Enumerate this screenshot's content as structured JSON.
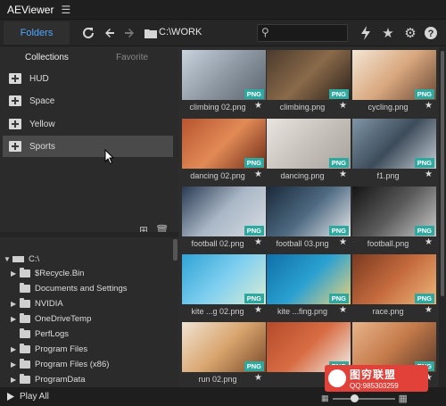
{
  "app": {
    "title": "AEViewer"
  },
  "toolbar": {
    "folders_tab": "Folders",
    "path": "C:\\WORK",
    "search_placeholder": ""
  },
  "left": {
    "tabs": [
      "Collections",
      "Favorite"
    ],
    "collections": [
      "HUD",
      "Space",
      "Yellow",
      "Sports"
    ],
    "selected_collection": "Sports",
    "tree": [
      {
        "label": "C:\\",
        "type": "drive",
        "expanded": true
      },
      {
        "label": "$Recycle.Bin",
        "type": "folder"
      },
      {
        "label": "Documents and Settings",
        "type": "folder-noarrow"
      },
      {
        "label": "NVIDIA",
        "type": "folder"
      },
      {
        "label": "OneDriveTemp",
        "type": "folder"
      },
      {
        "label": "PerfLogs",
        "type": "folder-noarrow"
      },
      {
        "label": "Program Files",
        "type": "folder"
      },
      {
        "label": "Program Files (x86)",
        "type": "folder"
      },
      {
        "label": "ProgramData",
        "type": "folder"
      }
    ]
  },
  "grid": {
    "badge": "PNG",
    "items": [
      {
        "name": "climbing 02.png",
        "colors": [
          "#c9d3dc",
          "#8e99a4",
          "#5a6570"
        ]
      },
      {
        "name": "climbing.png",
        "colors": [
          "#4a3a2c",
          "#8a6a4a",
          "#2b211a"
        ]
      },
      {
        "name": "cycling.png",
        "colors": [
          "#f4e6d4",
          "#d9a880",
          "#6b4a35"
        ]
      },
      {
        "name": "dancing 02.png",
        "colors": [
          "#b7542f",
          "#e28a56",
          "#6e2b18"
        ]
      },
      {
        "name": "dancing.png",
        "colors": [
          "#e9e4df",
          "#c8c2bd",
          "#a8a29c"
        ]
      },
      {
        "name": "f1.png",
        "colors": [
          "#7f95a6",
          "#3d4c5a",
          "#c4cdd4"
        ]
      },
      {
        "name": "football 02.png",
        "colors": [
          "#2a3a52",
          "#a9b7c6",
          "#d8dde3"
        ]
      },
      {
        "name": "football 03.png",
        "colors": [
          "#1a2a3a",
          "#4e6a82",
          "#e6e8ea"
        ]
      },
      {
        "name": "football.png",
        "colors": [
          "#141414",
          "#5a5a5a",
          "#c9c9c9"
        ]
      },
      {
        "name": "kite ...g 02.png",
        "colors": [
          "#2fa3d6",
          "#7fcff0",
          "#d9ecd4"
        ]
      },
      {
        "name": "kite ...fing.png",
        "colors": [
          "#0f6fa8",
          "#2ba1d1",
          "#e8d27a"
        ]
      },
      {
        "name": "race.png",
        "colors": [
          "#7a3a20",
          "#c56a3e",
          "#efb77a"
        ]
      },
      {
        "name": "run 02.png",
        "colors": [
          "#f0e3d2",
          "#d9a56e",
          "#7a4a2a"
        ]
      },
      {
        "name": "",
        "colors": [
          "#b44a2a",
          "#d86d44",
          "#f1efe9"
        ]
      },
      {
        "name": "",
        "colors": [
          "#e8b48a",
          "#c47a4a",
          "#5a3a2a"
        ]
      }
    ]
  },
  "status": {
    "play_all": "Play All",
    "zoom_value": 0.35
  },
  "watermark": {
    "line1": "图穷联盟",
    "line2": "QQ:985303259"
  }
}
